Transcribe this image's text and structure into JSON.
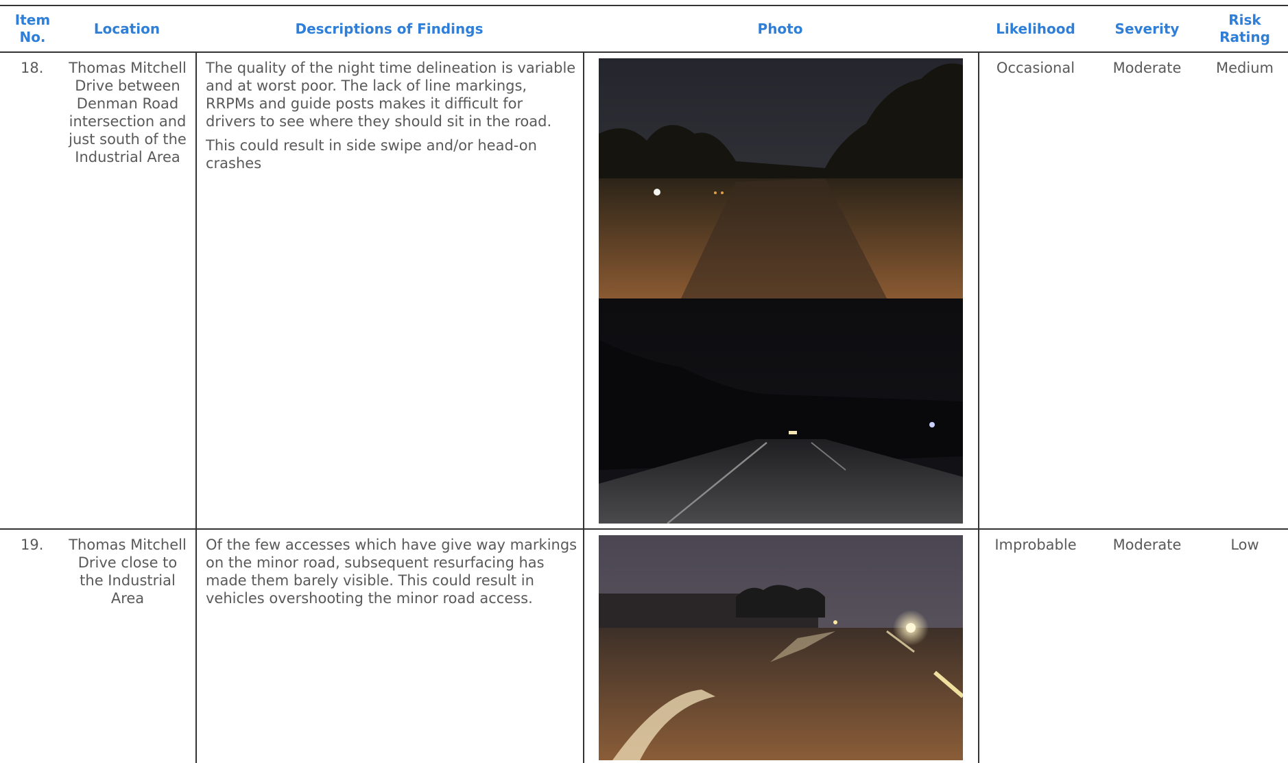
{
  "table": {
    "headers": {
      "item_no": "Item No.",
      "location": "Location",
      "description": "Descriptions of Findings",
      "photo": "Photo",
      "likelihood": "Likelihood",
      "severity": "Severity",
      "risk_rating": "Risk Rating"
    },
    "rows": [
      {
        "item": "18.",
        "location": "Thomas Mitchell Drive between Denman Road intersection and just south of the Industrial Area",
        "description_p1": "The quality of the night time delineation is variable and at worst poor. The lack of line markings, RRPMs and guide posts makes it difficult for drivers to see where they should sit in the road.",
        "description_p2": "This could result in side swipe and/or head-on crashes",
        "likelihood": "Occasional",
        "severity": "Moderate",
        "risk": "Medium"
      },
      {
        "item": "19.",
        "location": "Thomas Mitchell Drive close to the Industrial Area",
        "description_p1": "Of the few accesses which have give way markings on the minor road, subsequent resurfacing has made them barely visible. This could result in vehicles overshooting the minor road access.",
        "likelihood": "Improbable",
        "severity": "Moderate",
        "risk": "Low"
      }
    ]
  },
  "colors": {
    "header_text": "#2f7fd8",
    "body_text": "#595959",
    "rule": "#333333"
  }
}
